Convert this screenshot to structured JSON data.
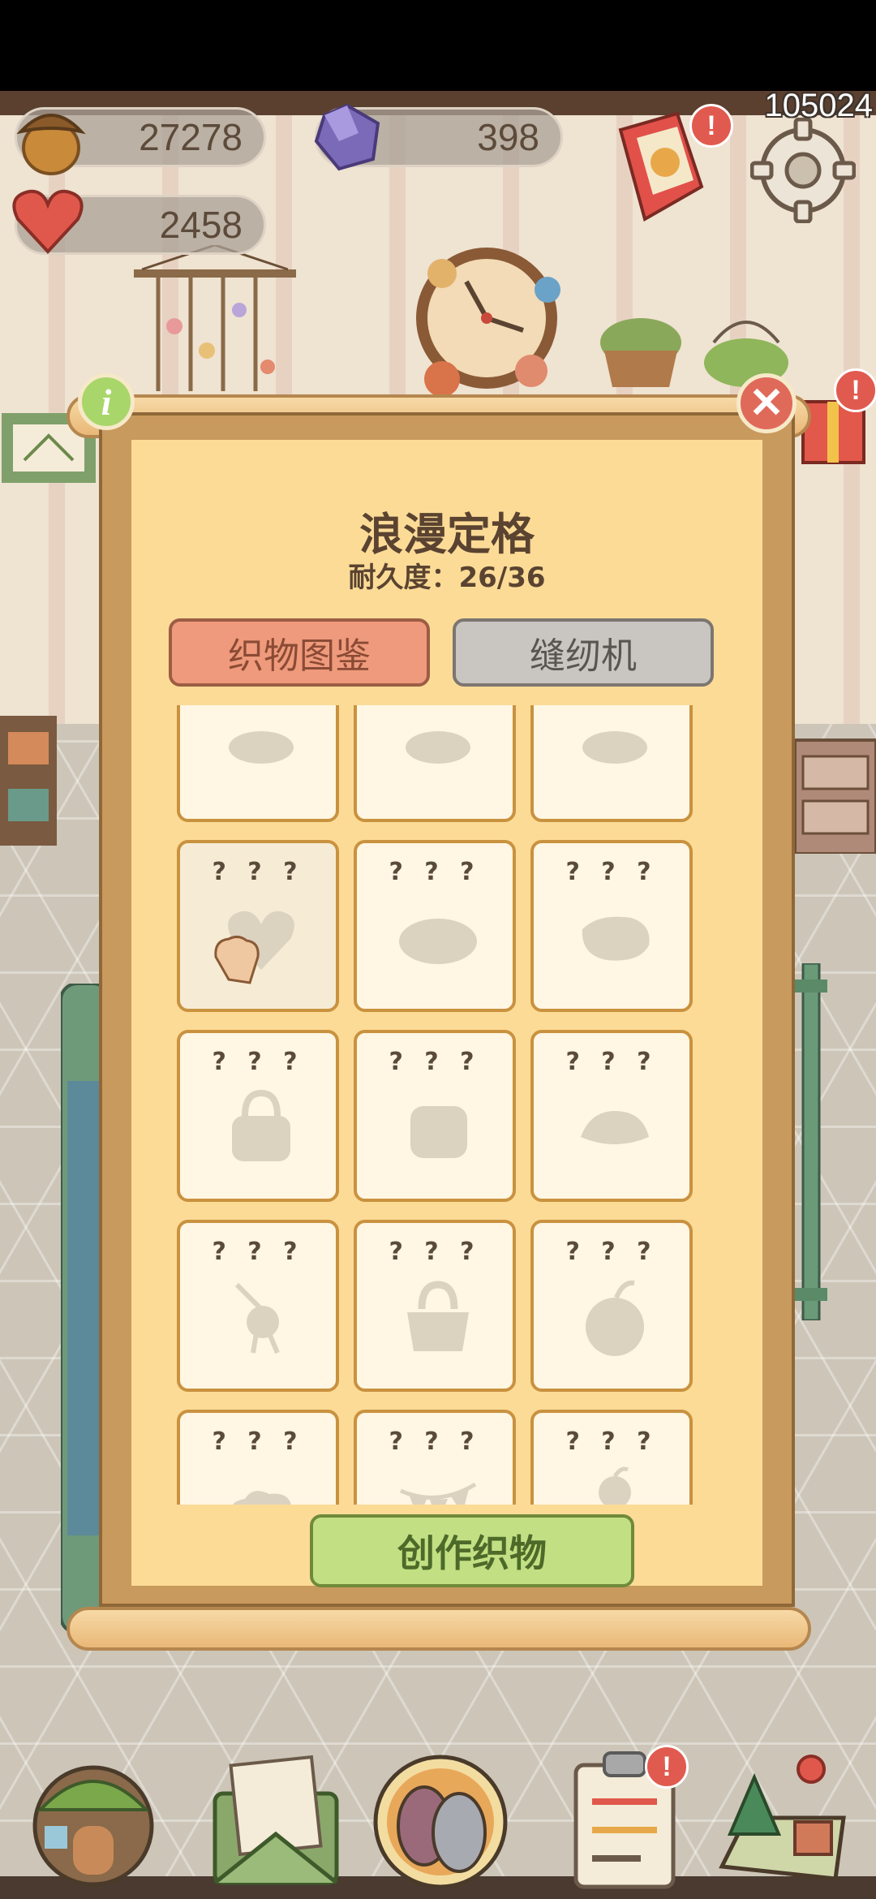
{
  "player_id": "105024",
  "currencies": {
    "acorns": "27278",
    "gems": "398",
    "hearts": "2458"
  },
  "panel": {
    "title": "浪漫定格",
    "durability": "耐久度：26/36",
    "tabs": [
      {
        "label": "织物图鉴",
        "active": true
      },
      {
        "label": "缝纫机",
        "active": false
      }
    ],
    "cards": [
      {
        "label": "",
        "silhouette": "partial-icon"
      },
      {
        "label": "",
        "silhouette": "partial-icon"
      },
      {
        "label": "",
        "silhouette": "partial-icon"
      },
      {
        "label": "? ? ?",
        "silhouette": "heart-icon"
      },
      {
        "label": "? ? ?",
        "silhouette": "oval-rug-icon"
      },
      {
        "label": "? ? ?",
        "silhouette": "cushion-icon"
      },
      {
        "label": "? ? ?",
        "silhouette": "handbag-icon"
      },
      {
        "label": "? ? ?",
        "silhouette": "pillow-icon"
      },
      {
        "label": "? ? ?",
        "silhouette": "hat-icon"
      },
      {
        "label": "? ? ?",
        "silhouette": "wind-chime-icon"
      },
      {
        "label": "? ? ?",
        "silhouette": "purse-icon"
      },
      {
        "label": "? ? ?",
        "silhouette": "fruit-icon"
      },
      {
        "label": "? ? ?",
        "silhouette": "cloud-cushion-icon"
      },
      {
        "label": "? ? ?",
        "silhouette": "bunting-icon"
      },
      {
        "label": "? ? ?",
        "silhouette": "doll-icon"
      },
      {
        "label": "",
        "silhouette": "partial-icon"
      },
      {
        "label": "",
        "silhouette": "partial-icon"
      },
      {
        "label": "",
        "silhouette": "partial-icon"
      }
    ],
    "create_button": "创作织物"
  },
  "badges": {
    "gift": "!",
    "side": "!",
    "tasks": "!"
  },
  "colors": {
    "accent_tab": "#ef9a7c",
    "create_button": "#c2e083",
    "panel_bg": "#fcdb97"
  }
}
